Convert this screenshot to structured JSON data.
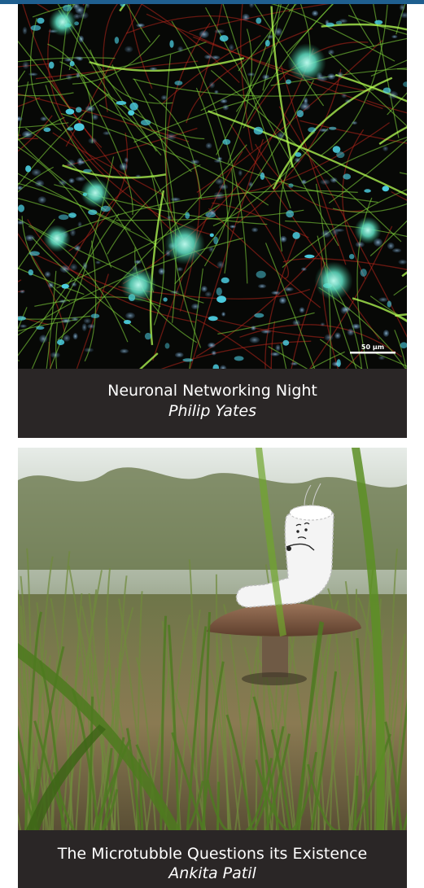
{
  "gallery": {
    "items": [
      {
        "title": "Neuronal Networking Night",
        "author": "Philip Yates",
        "scale_bar_label": "50 µm"
      },
      {
        "title": "The Microtubble Questions its Existence",
        "author": "Ankita Patil"
      }
    ]
  },
  "colors": {
    "accent_bar": "#1f5f8f",
    "caption_background": "#2a2626",
    "caption_text": "#ffffff"
  }
}
